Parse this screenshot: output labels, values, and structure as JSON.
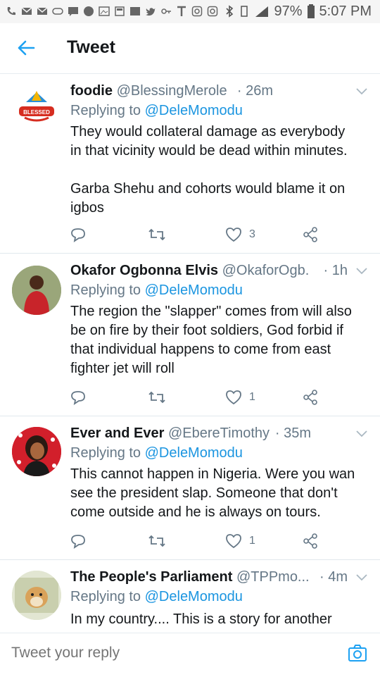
{
  "status_bar": {
    "battery": "97%",
    "time": "5:07 PM"
  },
  "header": {
    "title": "Tweet"
  },
  "tweets": [
    {
      "name": "foodie",
      "handle": "@BlessingMerole",
      "time": "· 26m",
      "replying_prefix": "Replying to",
      "replying_to": "@DeleMomodu",
      "body_lines": [
        "They would collateral damage as everybody",
        "in that vicinity would be dead within minutes.",
        "",
        "Garba Shehu and cohorts would blame it on",
        "igbos"
      ],
      "likes": "3",
      "avatar_text": "BLESSED"
    },
    {
      "name": "Okafor Ogbonna Elvis",
      "handle": "@OkaforOgb...",
      "time": "· 1h",
      "replying_prefix": "Replying to",
      "replying_to": "@DeleMomodu",
      "body_lines": [
        "The region the \"slapper\" comes from will also",
        "be on fire by their foot soldiers, God forbid if",
        "that individual happens to come from east",
        "fighter jet will roll"
      ],
      "likes": "1"
    },
    {
      "name": "Ever and Ever",
      "handle": "@EbereTimothy",
      "time": "· 35m",
      "replying_prefix": "Replying to",
      "replying_to": "@DeleMomodu",
      "body_lines": [
        "This cannot happen in Nigeria. Were you wan",
        "see the president slap. Someone that don't",
        "come outside and he is always on tours."
      ],
      "likes": "1"
    },
    {
      "name": "The People's Parliament",
      "handle": "@TPPmo...",
      "time": "· 4m",
      "replying_prefix": "Replying to",
      "replying_to": "@DeleMomodu",
      "body_lines": [
        "In my country.... This is a story for another"
      ]
    }
  ],
  "reply_bar": {
    "placeholder": "Tweet your reply"
  },
  "colors": {
    "accent": "#1da1f2",
    "mention": "#1b95e0",
    "muted": "#657786",
    "text": "#14171a"
  }
}
